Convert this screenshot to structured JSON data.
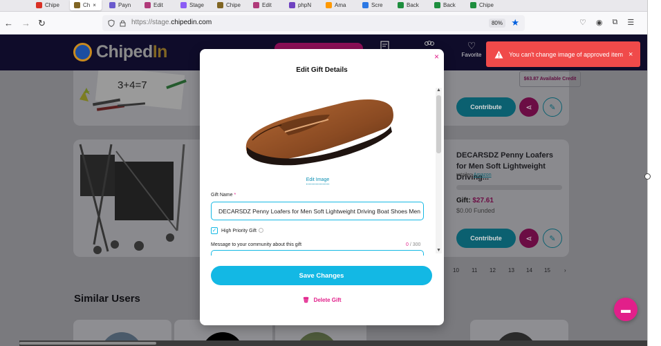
{
  "browser": {
    "tabs": [
      {
        "label": "Chipe",
        "color": "#d93025"
      },
      {
        "label": "Ch",
        "color": "#806523",
        "active": true
      },
      {
        "label": "Payn",
        "color": "#6a5acd"
      },
      {
        "label": "Edit",
        "color": "#b03a7a"
      },
      {
        "label": "Stage",
        "color": "#8b5cf6"
      },
      {
        "label": "Chipe",
        "color": "#806523"
      },
      {
        "label": "Edit",
        "color": "#b03a7a"
      },
      {
        "label": "phpN",
        "color": "#6f42c1"
      },
      {
        "label": "Ama",
        "color": "#ff9900"
      },
      {
        "label": "Scre",
        "color": "#2b78e4"
      },
      {
        "label": "Back",
        "color": "#1e8e3e"
      },
      {
        "label": "Back",
        "color": "#1e8e3e"
      },
      {
        "label": "Chipe",
        "color": "#1e8e3e"
      }
    ],
    "close_tab_symbol": "×",
    "url_prefix": "https://stage.",
    "url_domain": "chipedin.com",
    "zoom": "80%",
    "back_symbol": "←",
    "forward_symbol": "→",
    "reload_symbol": "↻"
  },
  "header": {
    "logo_prefix": "Chiped",
    "logo_suffix": "In",
    "favorite_label": "Favorite"
  },
  "credit": "$63.87 Available Credit",
  "gift_cards": [
    {
      "title": "",
      "contribute_label": "Contribute"
    },
    {
      "title": "DECARSDZ Penny Loafers for Men Soft Lightweight Driving...",
      "retailer_label": "retailer:",
      "retailer_name": "Amazon",
      "gift_label": "Gift:",
      "gift_price": "$27.61",
      "funded": "$0.00 Funded",
      "contribute_label": "Contribute"
    }
  ],
  "pagination": [
    "10",
    "11",
    "12",
    "13",
    "14",
    "15",
    "›"
  ],
  "similar_users_heading": "Similar Users",
  "modal": {
    "title": "Edit Gift Details",
    "close_symbol": "×",
    "edit_image_label": "Edit Image",
    "gift_name_label": "Gift Name",
    "gift_name_required": "*",
    "gift_name_value": "DECARSDZ Penny Loafers for Men Soft Lightweight Driving Boat Shoes Men",
    "high_priority_label": "High Priority Gift",
    "high_priority_checked": true,
    "message_label": "Message to your community about this gift",
    "message_count": "0",
    "message_max": "/ 300",
    "save_label": "Save Changes",
    "delete_label": "Delete Gift"
  },
  "toast": {
    "message": "You can't change image of approved item",
    "close_symbol": "×",
    "color": "#f04a4a"
  },
  "colors": {
    "accent_blue": "#13b8e4",
    "accent_pink": "#e21f8a",
    "header_bg": "#0f0c2a"
  }
}
